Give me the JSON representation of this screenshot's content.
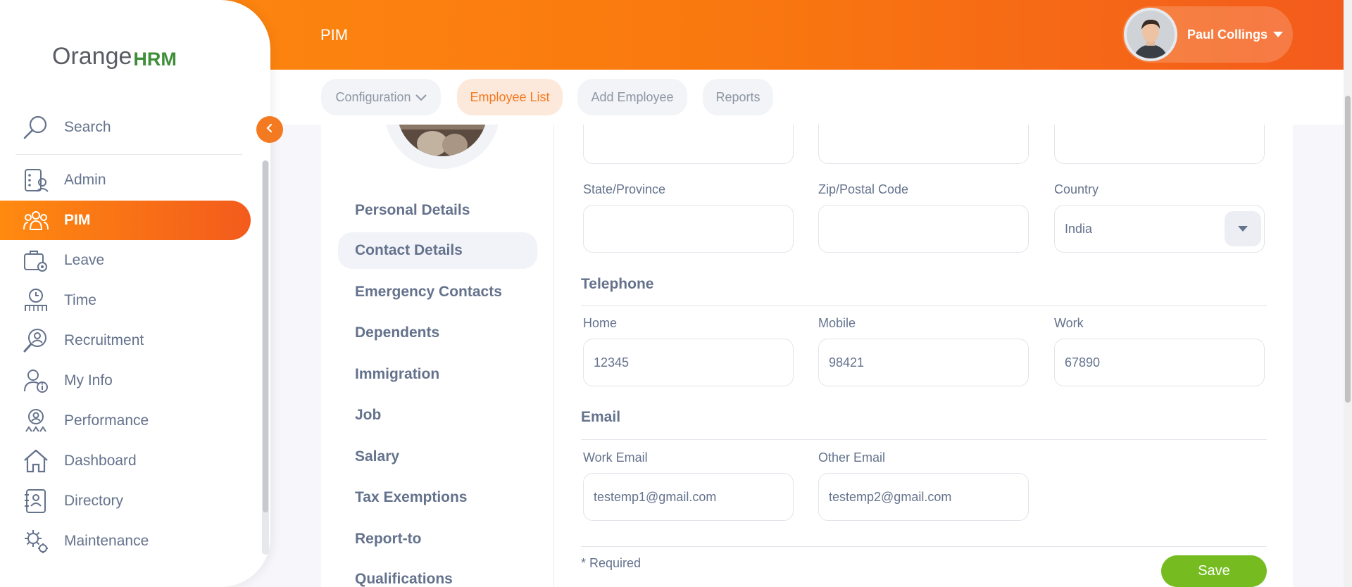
{
  "topbar": {
    "title": "PIM",
    "user_name": "Paul Collings"
  },
  "subnav": {
    "tabs": [
      {
        "label": "Configuration"
      },
      {
        "label": "Employee List"
      },
      {
        "label": "Add Employee"
      },
      {
        "label": "Reports"
      }
    ],
    "active_tab": "Employee List"
  },
  "sidebar": {
    "logo_main": "Orange",
    "logo_suffix": "HRM",
    "search_label": "Search",
    "items": [
      {
        "label": "Admin",
        "icon": "admin-icon"
      },
      {
        "label": "PIM",
        "icon": "pim-icon"
      },
      {
        "label": "Leave",
        "icon": "leave-icon"
      },
      {
        "label": "Time",
        "icon": "time-icon"
      },
      {
        "label": "Recruitment",
        "icon": "recruitment-icon"
      },
      {
        "label": "My Info",
        "icon": "my-info-icon"
      },
      {
        "label": "Performance",
        "icon": "performance-icon"
      },
      {
        "label": "Dashboard",
        "icon": "dashboard-icon"
      },
      {
        "label": "Directory",
        "icon": "directory-icon"
      },
      {
        "label": "Maintenance",
        "icon": "maintenance-icon"
      }
    ],
    "active_item": "PIM"
  },
  "profile_tabs": {
    "items": [
      "Personal Details",
      "Contact Details",
      "Emergency Contacts",
      "Dependents",
      "Immigration",
      "Job",
      "Salary",
      "Tax Exemptions",
      "Report-to",
      "Qualifications"
    ],
    "active": "Contact Details"
  },
  "address": {
    "state_label": "State/Province",
    "state_value": "",
    "zip_label": "Zip/Postal Code",
    "zip_value": "",
    "country_label": "Country",
    "country_value": "India"
  },
  "telephone": {
    "title": "Telephone",
    "home_label": "Home",
    "home_value": "12345",
    "mobile_label": "Mobile",
    "mobile_value": "98421",
    "work_label": "Work",
    "work_value": "67890"
  },
  "email": {
    "title": "Email",
    "work_label": "Work Email",
    "work_value": "testemp1@gmail.com",
    "other_label": "Other Email",
    "other_value": "testemp2@gmail.com"
  },
  "form": {
    "required_note": "* Required",
    "save_label": "Save"
  },
  "colors": {
    "brand_orange": "#f47a21",
    "save_green": "#76bc21",
    "text": "#64728c"
  }
}
